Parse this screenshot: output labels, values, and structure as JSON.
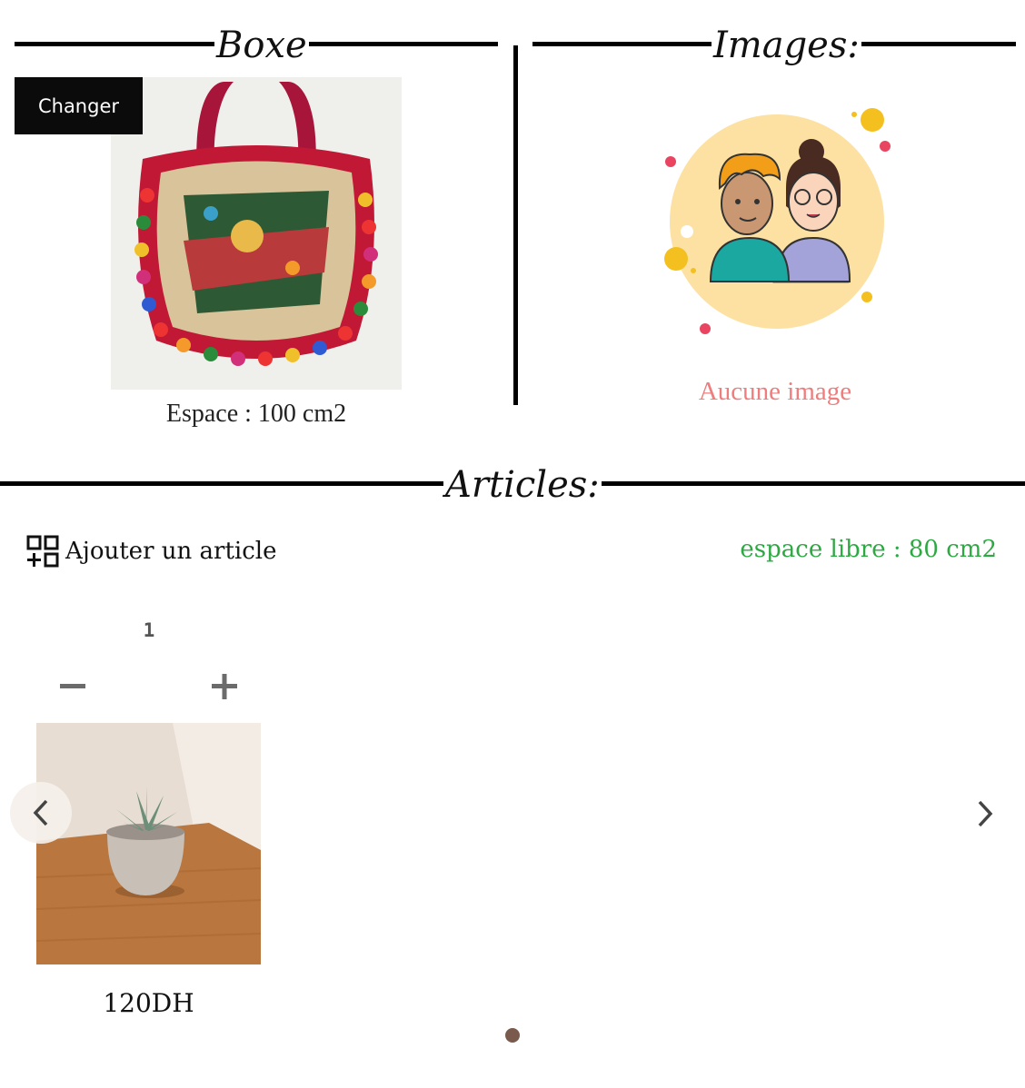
{
  "box_section": {
    "title": "Boxe",
    "change_button": "Changer",
    "space_label": "Espace : 100 cm2",
    "product_image": "embroidered-bag-photo"
  },
  "images_section": {
    "title": "Images:",
    "empty_text": "Aucune image",
    "placeholder_image": "two-people-avatar-illustration"
  },
  "articles_section": {
    "title": "Articles:",
    "add_button": "Ajouter un article",
    "add_icon": "add-grid-icon",
    "free_space": "espace libre : 80 cm2",
    "items": [
      {
        "quantity": "1",
        "price": "120DH",
        "image": "succulent-plant-photo"
      }
    ],
    "carousel": {
      "prev_icon": "chevron-left-icon",
      "next_icon": "chevron-right-icon",
      "page_count": 1,
      "active_page": 1
    }
  },
  "colors": {
    "free_space": "#2ea843",
    "empty_text": "#ef7d7d",
    "button_bg": "#0b0b0b",
    "dot": "#7a5a4c"
  }
}
